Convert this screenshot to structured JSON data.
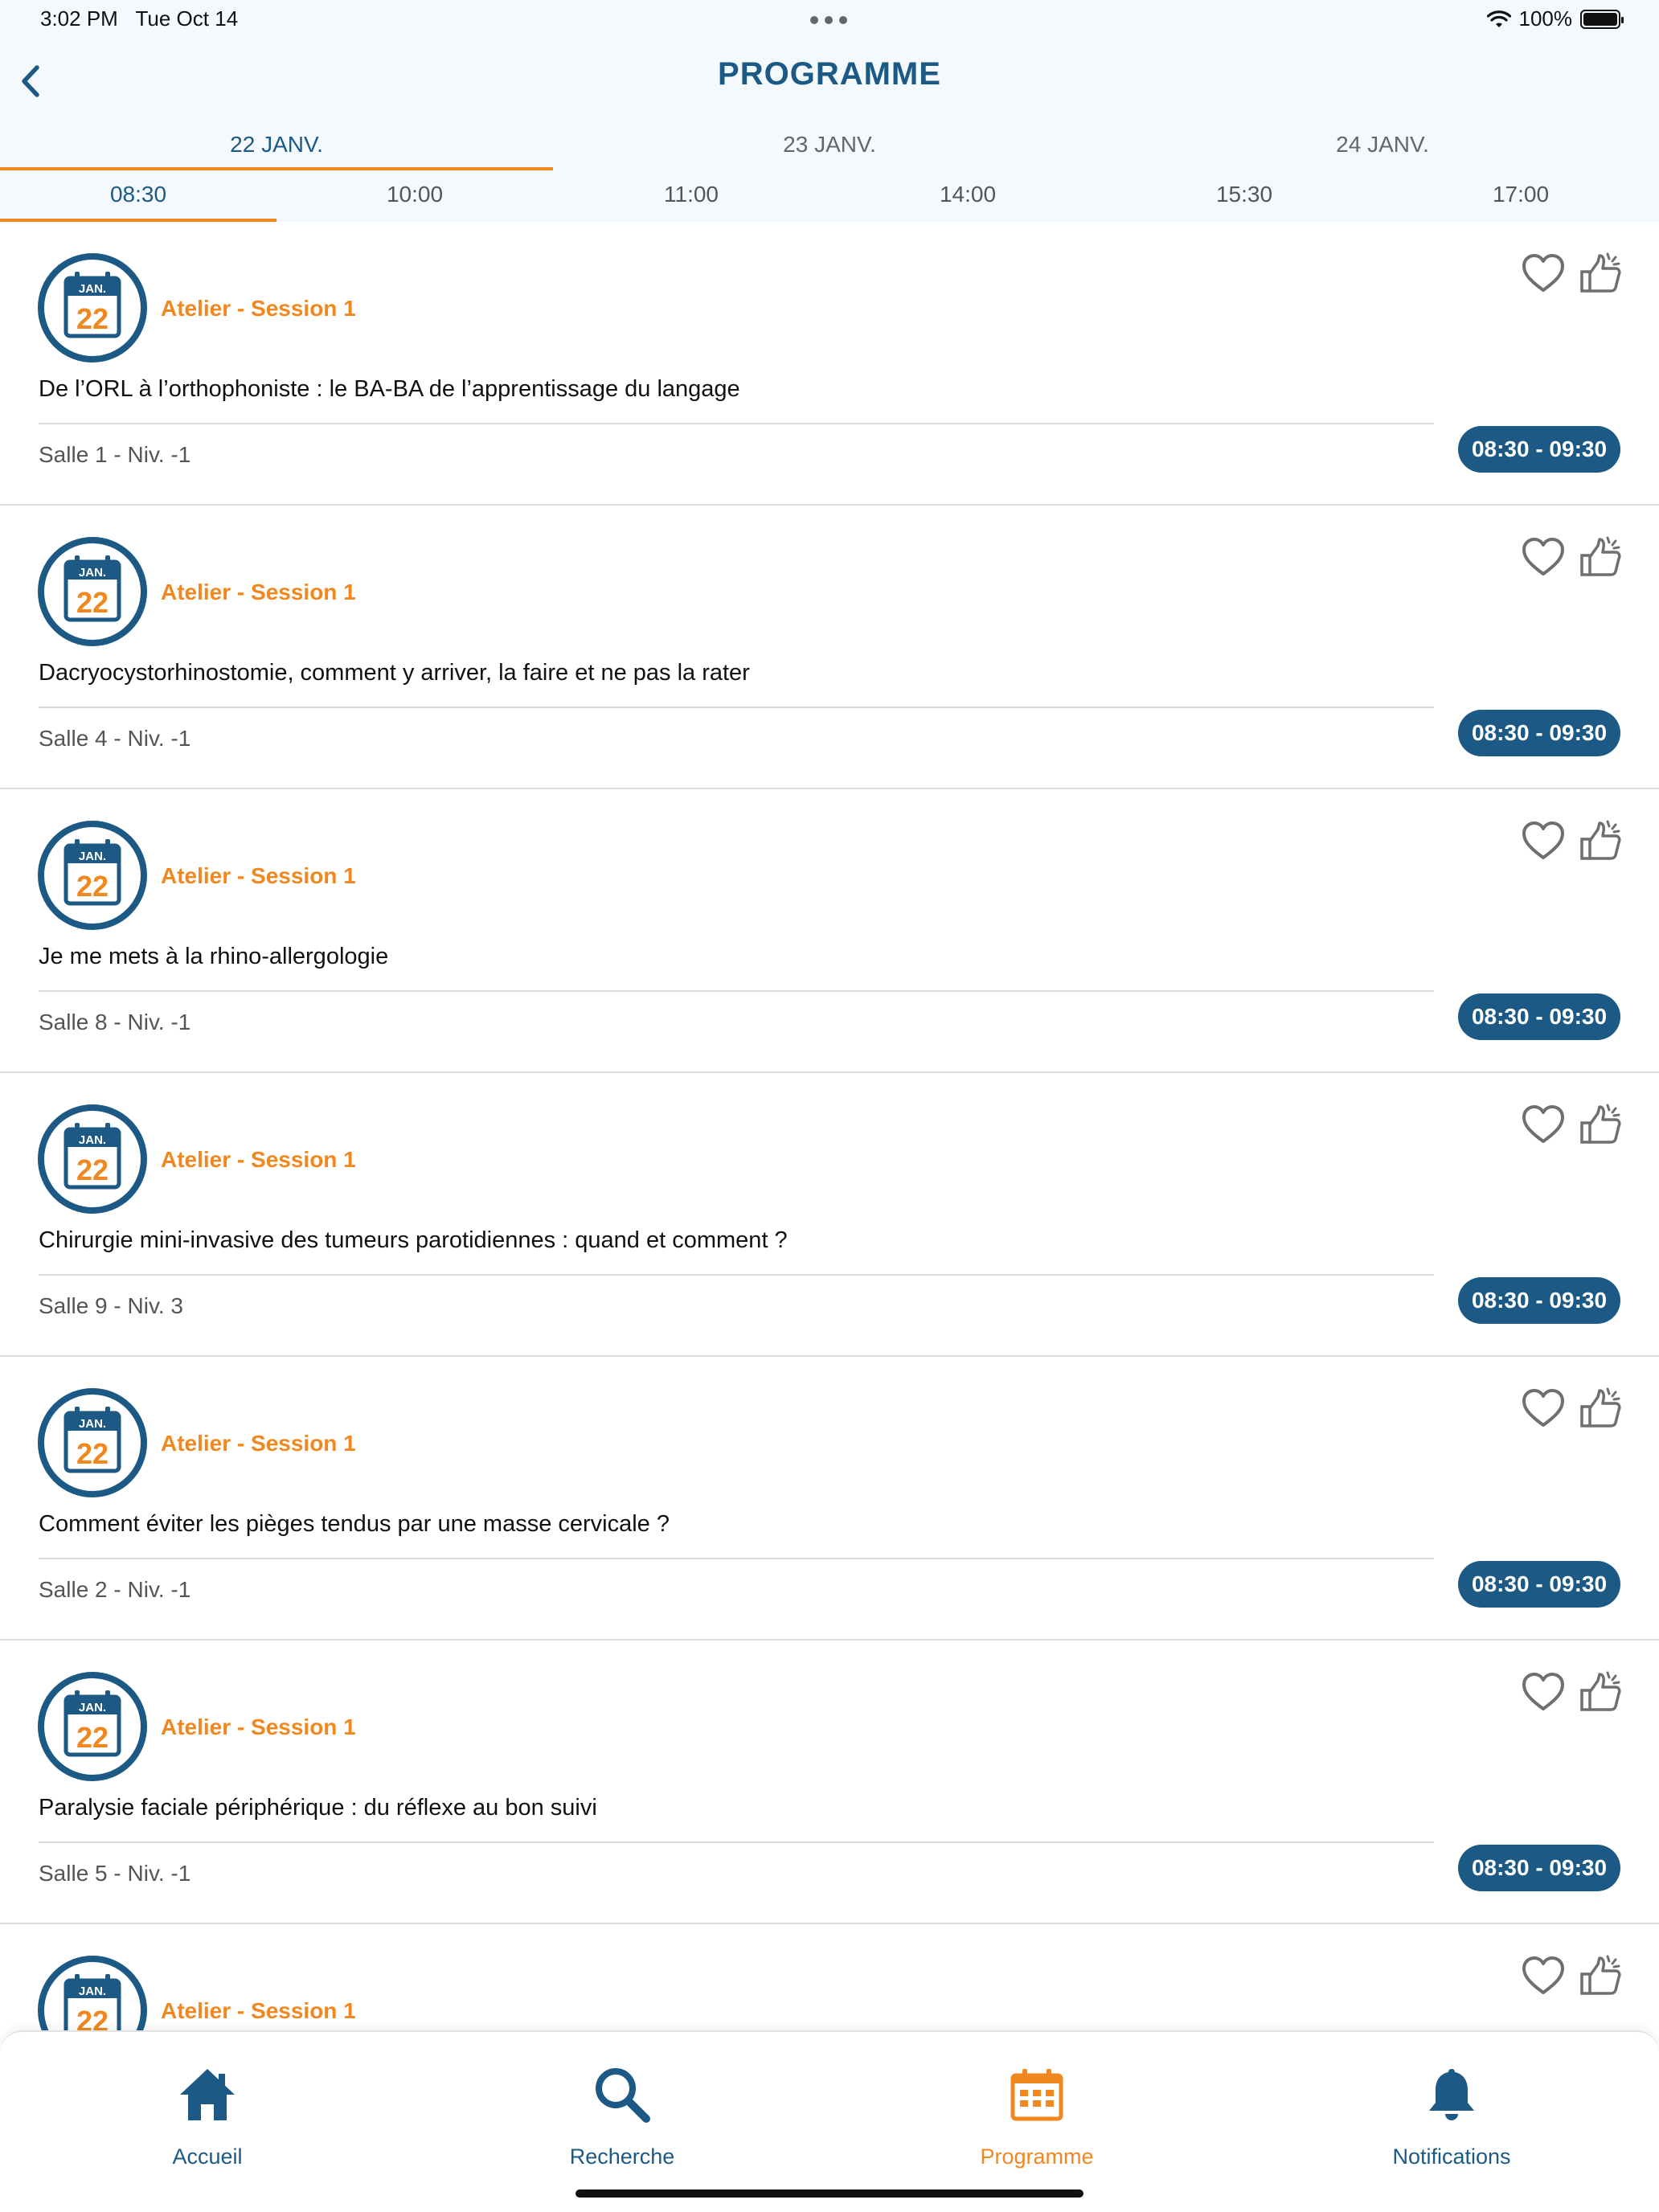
{
  "status_bar": {
    "time": "3:02 PM",
    "date": "Tue Oct 14",
    "battery": "100%"
  },
  "header": {
    "title": "PROGRAMME"
  },
  "days": [
    {
      "label": "22 JANV.",
      "active": true
    },
    {
      "label": "23 JANV.",
      "active": false
    },
    {
      "label": "24 JANV.",
      "active": false
    }
  ],
  "time_slots": [
    {
      "label": "08:30",
      "active": true
    },
    {
      "label": "10:00",
      "active": false
    },
    {
      "label": "11:00",
      "active": false
    },
    {
      "label": "14:00",
      "active": false
    },
    {
      "label": "15:30",
      "active": false
    },
    {
      "label": "17:00",
      "active": false
    }
  ],
  "calendar_icon": {
    "month": "JAN.",
    "day": "22"
  },
  "sessions": [
    {
      "type": "Atelier - Session 1",
      "title": "De l’ORL à l’orthophoniste : le BA-BA de l’apprentissage du langage",
      "room": "Salle 1 - Niv. -1",
      "time": "08:30 - 09:30"
    },
    {
      "type": "Atelier - Session 1",
      "title": "Dacryocystorhinostomie, comment y arriver, la faire et ne pas la rater",
      "room": "Salle 4 - Niv. -1",
      "time": "08:30 - 09:30"
    },
    {
      "type": "Atelier - Session 1",
      "title": "Je me mets à la rhino-allergologie",
      "room": "Salle 8 - Niv. -1",
      "time": "08:30 - 09:30"
    },
    {
      "type": "Atelier - Session 1",
      "title": "Chirurgie mini-invasive des tumeurs parotidiennes : quand et comment ?",
      "room": "Salle 9 - Niv. 3",
      "time": "08:30 - 09:30"
    },
    {
      "type": "Atelier - Session 1",
      "title": "Comment éviter les pièges tendus par une masse cervicale ?",
      "room": "Salle 2 - Niv. -1",
      "time": "08:30 - 09:30"
    },
    {
      "type": "Atelier - Session 1",
      "title": "Paralysie faciale périphérique : du réflexe au bon suivi",
      "room": "Salle 5 - Niv. -1",
      "time": "08:30 - 09:30"
    },
    {
      "type": "Atelier - Session 1",
      "title": "",
      "room": "",
      "time": ""
    }
  ],
  "tab_bar": [
    {
      "label": "Accueil",
      "icon": "home-icon",
      "active": false
    },
    {
      "label": "Recherche",
      "icon": "search-icon",
      "active": false
    },
    {
      "label": "Programme",
      "icon": "calendar-icon",
      "active": true
    },
    {
      "label": "Notifications",
      "icon": "bell-icon",
      "active": false
    }
  ],
  "colors": {
    "primary": "#1c5a85",
    "accent": "#f0871f",
    "header_bg": "#f4f9fd"
  }
}
